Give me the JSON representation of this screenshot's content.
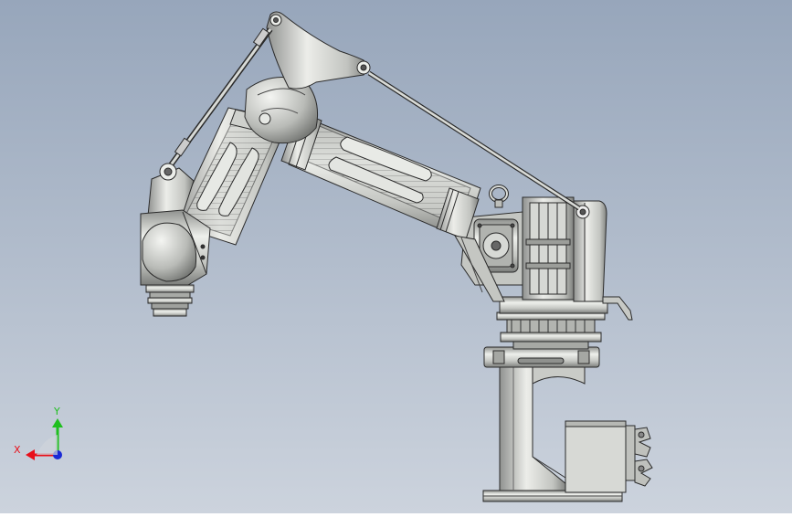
{
  "triad": {
    "x_label": "X",
    "y_label": "Y",
    "x_color": "#e8101a",
    "y_color": "#1fbf1f",
    "z_color": "#1a2ad6"
  },
  "colors": {
    "background_top": "#9aa9bd",
    "background_bottom": "#c9d1dc",
    "metal_light": "#e4e6e2",
    "metal_mid": "#bfc1bd",
    "metal_dark": "#8c8e8b",
    "edge": "#2a2a2a"
  }
}
